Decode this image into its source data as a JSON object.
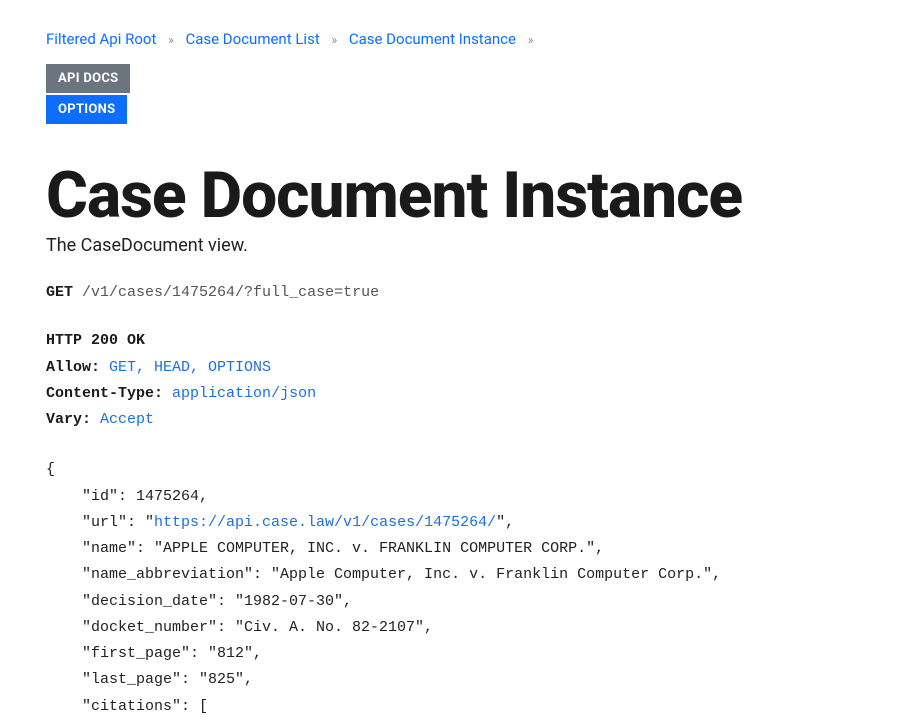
{
  "breadcrumbs": {
    "items": [
      {
        "label": "Filtered Api Root"
      },
      {
        "label": "Case Document List"
      },
      {
        "label": "Case Document Instance"
      }
    ],
    "sep": "»"
  },
  "buttons": {
    "api_docs": "API DOCS",
    "options": "OPTIONS"
  },
  "title": "Case Document Instance",
  "subtitle": "The CaseDocument view.",
  "request": {
    "method": "GET",
    "path": "/v1/cases/1475264/?full_case=true"
  },
  "response": {
    "status": "HTTP 200 OK",
    "allow_label": "Allow:",
    "allow_value": "GET, HEAD, OPTIONS",
    "ctype_label": "Content-Type:",
    "ctype_value": "application/json",
    "vary_label": "Vary:",
    "vary_value": "Accept"
  },
  "json": {
    "open": "{",
    "id_line": "    \"id\": 1475264,",
    "url_pre": "    \"url\": \"",
    "url_link": "https://api.case.law/v1/cases/1475264/",
    "url_post": "\",",
    "name_line": "    \"name\": \"APPLE COMPUTER, INC. v. FRANKLIN COMPUTER CORP.\",",
    "abbr_line": "    \"name_abbreviation\": \"Apple Computer, Inc. v. Franklin Computer Corp.\",",
    "date_line": "    \"decision_date\": \"1982-07-30\",",
    "docket_line": "    \"docket_number\": \"Civ. A. No. 82-2107\",",
    "first_line": "    \"first_page\": \"812\",",
    "last_line": "    \"last_page\": \"825\",",
    "citations_line": "    \"citations\": ["
  }
}
